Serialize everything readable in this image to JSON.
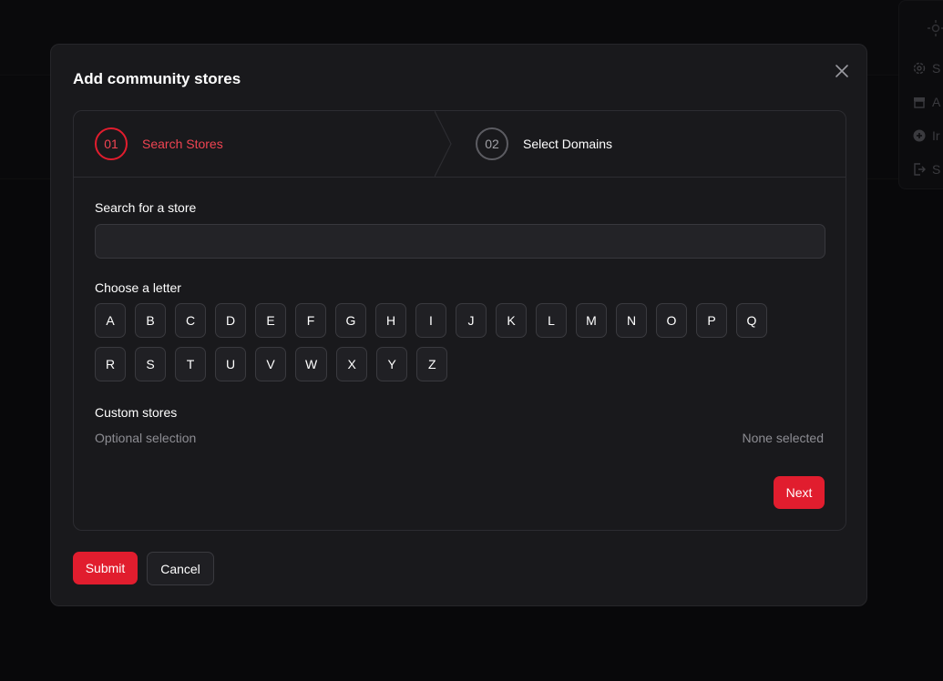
{
  "background_menu": {
    "items": [
      {
        "icon": "gear-icon",
        "label": "S"
      },
      {
        "icon": "store-icon",
        "label": "A"
      },
      {
        "icon": "plus-circle-icon",
        "label": "Ir"
      },
      {
        "icon": "logout-icon",
        "label": "S"
      }
    ]
  },
  "modal": {
    "title": "Add community stores",
    "close_icon": "close-icon",
    "steps": [
      {
        "number": "01",
        "label": "Search Stores",
        "active": true
      },
      {
        "number": "02",
        "label": "Select Domains",
        "active": false
      }
    ],
    "search": {
      "label": "Search for a store",
      "value": "",
      "placeholder": ""
    },
    "letters": {
      "label": "Choose a letter",
      "rows": [
        [
          "A",
          "B",
          "C",
          "D",
          "E",
          "F",
          "G",
          "H",
          "I",
          "J",
          "K",
          "L",
          "M",
          "N",
          "O",
          "P",
          "Q"
        ],
        [
          "R",
          "S",
          "T",
          "U",
          "V",
          "W",
          "X",
          "Y",
          "Z"
        ]
      ]
    },
    "custom_stores": {
      "label": "Custom stores",
      "sublabel": "Optional selection",
      "status": "None selected"
    },
    "next_label": "Next",
    "submit_label": "Submit",
    "cancel_label": "Cancel"
  },
  "colors": {
    "accent": "#e11d2e",
    "accent_text": "#f04452",
    "modal_bg": "#19191c",
    "page_bg": "#0d0d10"
  }
}
